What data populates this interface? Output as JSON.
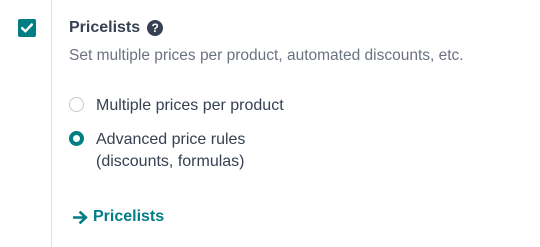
{
  "setting": {
    "enabled": true,
    "title": "Pricelists",
    "description": "Set multiple prices per product, automated discounts, etc.",
    "options": [
      {
        "label": "Multiple prices per product",
        "selected": false
      },
      {
        "label_line1": "Advanced price rules",
        "label_line2": "(discounts, formulas)",
        "selected": true
      }
    ],
    "link_label": "Pricelists",
    "icons": {
      "checkbox": "check-icon",
      "help": "question-circle-icon",
      "link": "arrow-right-icon"
    },
    "help_glyph": "?",
    "colors": {
      "accent": "#017e84",
      "text": "#374151",
      "muted": "#6b7280"
    }
  }
}
